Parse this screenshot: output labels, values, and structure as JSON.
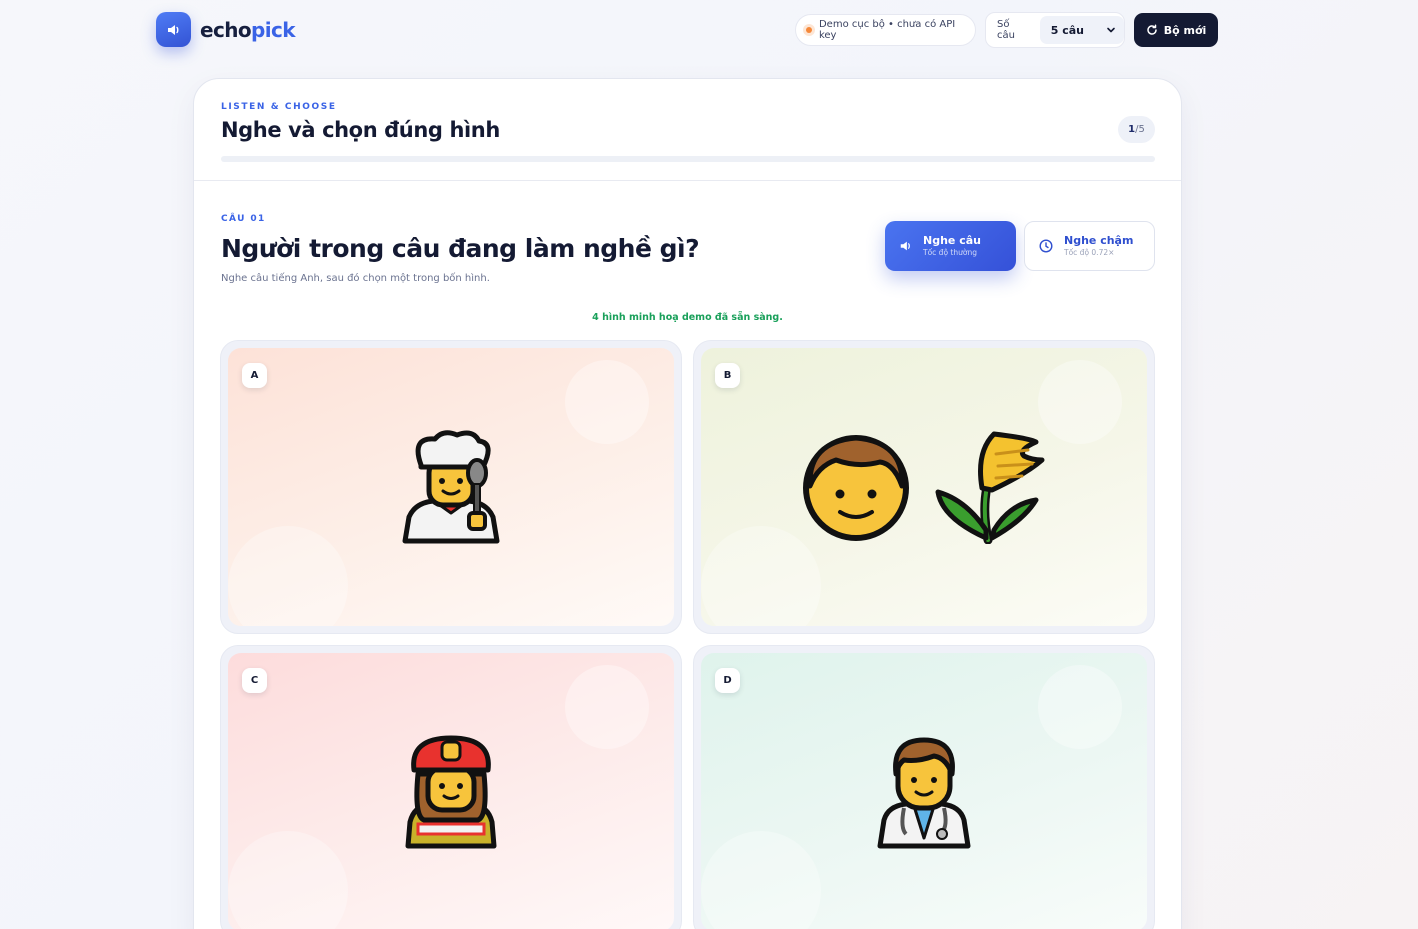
{
  "header": {
    "brand_part1": "echo",
    "brand_part2": "pick",
    "demo_status": "Demo cục bộ • chưa có API key",
    "count_label": "Số câu",
    "count_value": "5 câu",
    "new_set_label": "Bộ mới"
  },
  "quiz": {
    "eyebrow": "LISTEN & CHOOSE",
    "title": "Nghe và chọn đúng hình",
    "progress_current": "1",
    "progress_total": "/5",
    "progress_fraction": 0.2,
    "question_label": "CÂU 01",
    "question_text": "Người trong câu đang làm nghề gì?",
    "question_sub": "Nghe câu tiếng Anh, sau đó chọn một trong bốn hình.",
    "play_label": "Nghe câu",
    "play_sub": "Tốc độ thường",
    "slow_label": "Nghe chậm",
    "slow_sub": "Tốc độ 0.72×",
    "ready_text": "4 hình minh hoạ demo đã sẵn sàng."
  },
  "options": [
    {
      "letter": "A",
      "icon": "woman-cook-icon"
    },
    {
      "letter": "B",
      "icon": "farmer-with-rice-icon"
    },
    {
      "letter": "C",
      "icon": "woman-firefighter-icon"
    },
    {
      "letter": "D",
      "icon": "man-doctor-icon"
    }
  ],
  "colors": {
    "accent": "#3a63e6",
    "dark": "#141a33",
    "success": "#19a05a"
  }
}
